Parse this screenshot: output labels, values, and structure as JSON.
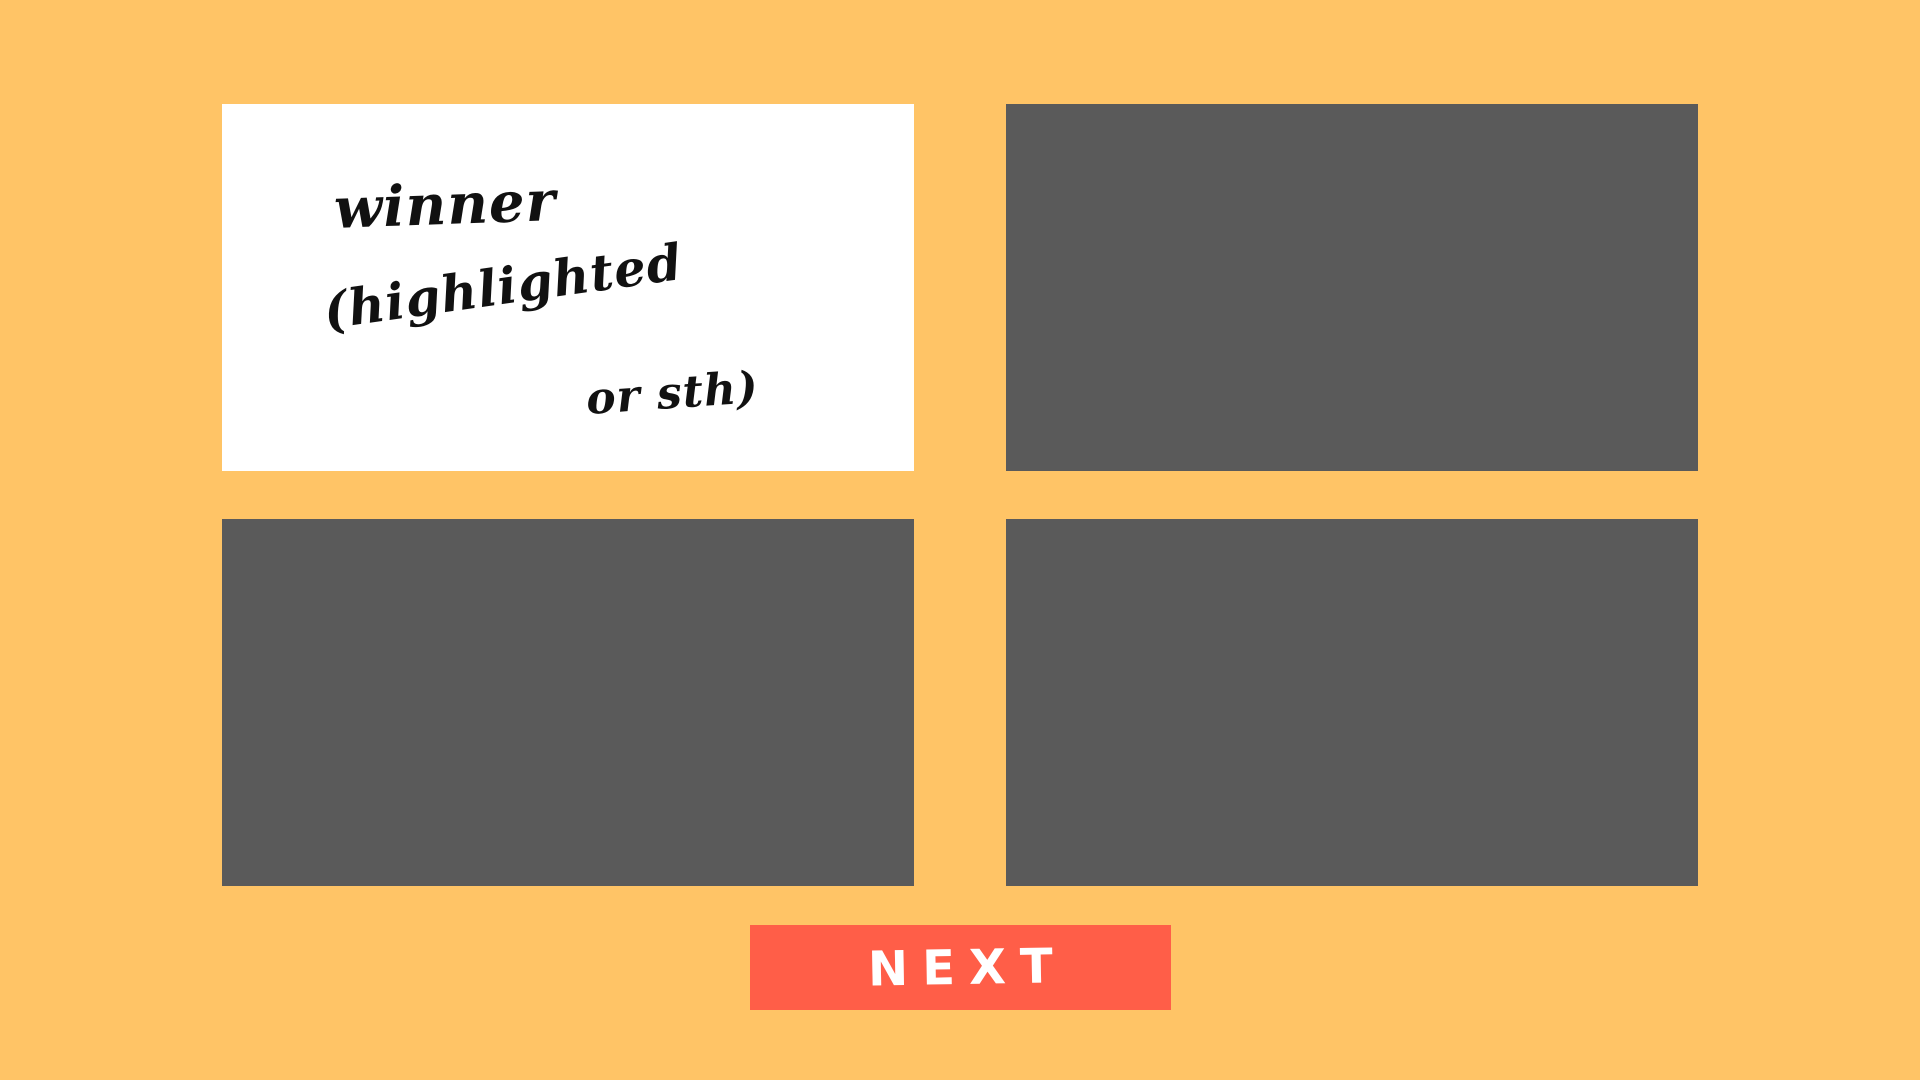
{
  "colors": {
    "background": "#ffc466",
    "tile_placeholder": "#5a5a5a",
    "tile_winner": "#ffffff",
    "next_button": "#ff5e48",
    "next_text": "#ffffff",
    "ink": "#111111"
  },
  "tiles": [
    {
      "state": "winner",
      "note_lines": [
        "winner",
        "(highlighted",
        "or sth)"
      ]
    },
    {
      "state": "placeholder"
    },
    {
      "state": "placeholder"
    },
    {
      "state": "placeholder"
    }
  ],
  "next_button": {
    "label": "NEXT"
  }
}
